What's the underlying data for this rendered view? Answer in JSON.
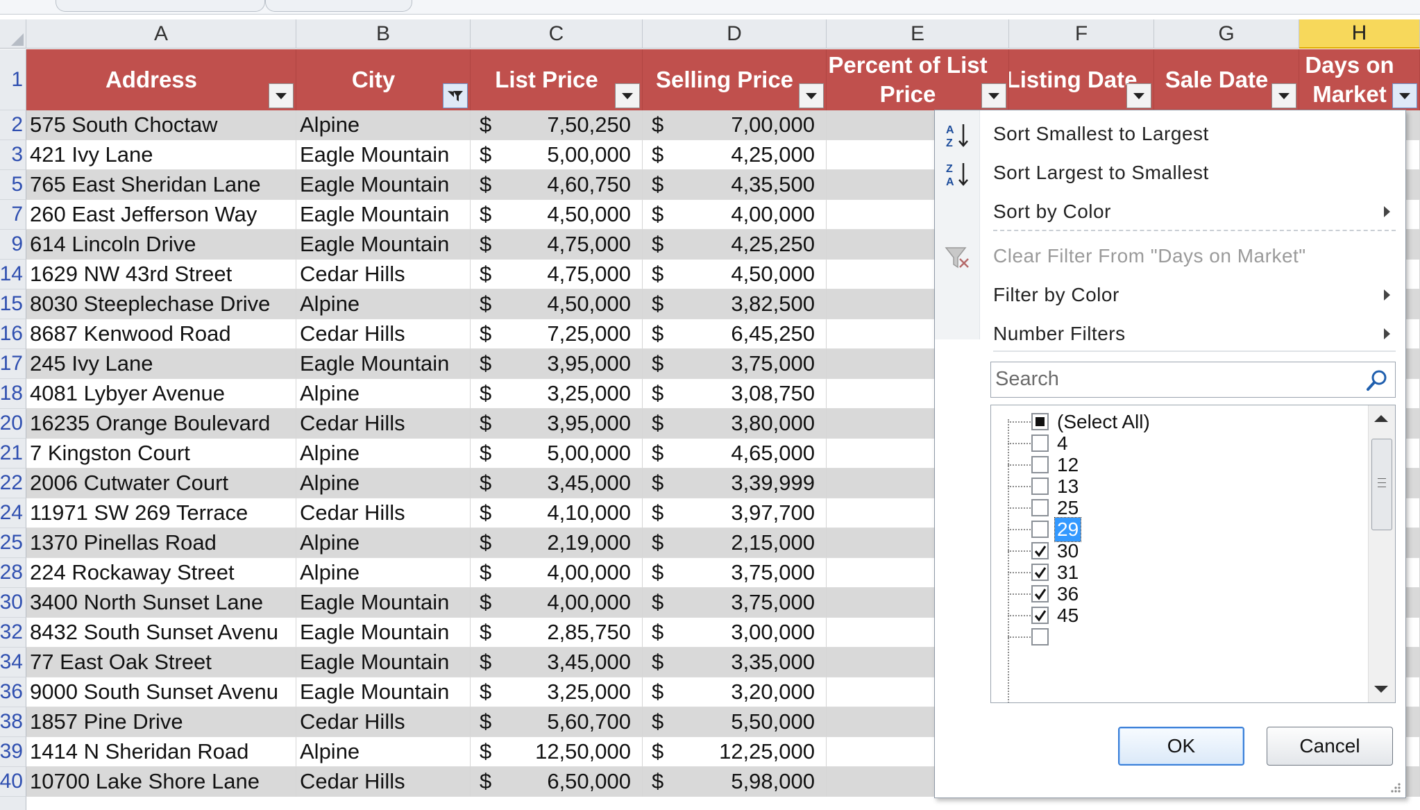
{
  "columns": [
    "A",
    "B",
    "C",
    "D",
    "E",
    "F",
    "G",
    "H"
  ],
  "header_row_number": "1",
  "table_headers": {
    "address": "Address",
    "city": "City",
    "list_price": "List Price",
    "selling_price": "Selling Price",
    "percent_of_list_price": "Percent of List Price",
    "listing_date": "Listing Date",
    "sale_date": "Sale Date",
    "days_on_market": "Days on Market"
  },
  "currency_symbol": "$",
  "rows": [
    {
      "row": "2",
      "address": "575 South Choctaw",
      "city": "Alpine",
      "list_price": "7,50,250",
      "selling_price": "7,00,000"
    },
    {
      "row": "3",
      "address": "421 Ivy Lane",
      "city": "Eagle Mountain",
      "list_price": "5,00,000",
      "selling_price": "4,25,000"
    },
    {
      "row": "5",
      "address": "765 East Sheridan Lane",
      "city": "Eagle Mountain",
      "list_price": "4,60,750",
      "selling_price": "4,35,500"
    },
    {
      "row": "7",
      "address": "260 East Jefferson Way",
      "city": "Eagle Mountain",
      "list_price": "4,50,000",
      "selling_price": "4,00,000"
    },
    {
      "row": "9",
      "address": "614 Lincoln Drive",
      "city": "Eagle Mountain",
      "list_price": "4,75,000",
      "selling_price": "4,25,250"
    },
    {
      "row": "14",
      "address": "1629 NW 43rd Street",
      "city": "Cedar Hills",
      "list_price": "4,75,000",
      "selling_price": "4,50,000"
    },
    {
      "row": "15",
      "address": "8030 Steeplechase Drive",
      "city": "Alpine",
      "list_price": "4,50,000",
      "selling_price": "3,82,500"
    },
    {
      "row": "16",
      "address": "8687 Kenwood Road",
      "city": "Cedar Hills",
      "list_price": "7,25,000",
      "selling_price": "6,45,250"
    },
    {
      "row": "17",
      "address": "245 Ivy Lane",
      "city": "Eagle Mountain",
      "list_price": "3,95,000",
      "selling_price": "3,75,000"
    },
    {
      "row": "18",
      "address": "4081 Lybyer Avenue",
      "city": "Alpine",
      "list_price": "3,25,000",
      "selling_price": "3,08,750"
    },
    {
      "row": "20",
      "address": "16235 Orange Boulevard",
      "city": "Cedar Hills",
      "list_price": "3,95,000",
      "selling_price": "3,80,000"
    },
    {
      "row": "21",
      "address": "7 Kingston Court",
      "city": "Alpine",
      "list_price": "5,00,000",
      "selling_price": "4,65,000"
    },
    {
      "row": "22",
      "address": "2006 Cutwater Court",
      "city": "Alpine",
      "list_price": "3,45,000",
      "selling_price": "3,39,999"
    },
    {
      "row": "24",
      "address": "11971 SW 269 Terrace",
      "city": "Cedar Hills",
      "list_price": "4,10,000",
      "selling_price": "3,97,700"
    },
    {
      "row": "25",
      "address": "1370 Pinellas Road",
      "city": "Alpine",
      "list_price": "2,19,000",
      "selling_price": "2,15,000"
    },
    {
      "row": "28",
      "address": "224 Rockaway Street",
      "city": "Alpine",
      "list_price": "4,00,000",
      "selling_price": "3,75,000"
    },
    {
      "row": "30",
      "address": "3400 North Sunset Lane",
      "city": "Eagle Mountain",
      "list_price": "4,00,000",
      "selling_price": "3,75,000"
    },
    {
      "row": "32",
      "address": "8432 South Sunset Avenu",
      "city": "Eagle Mountain",
      "list_price": "2,85,750",
      "selling_price": "3,00,000"
    },
    {
      "row": "34",
      "address": "77 East Oak Street",
      "city": "Eagle Mountain",
      "list_price": "3,45,000",
      "selling_price": "3,35,000"
    },
    {
      "row": "36",
      "address": "9000 South Sunset Avenu",
      "city": "Eagle Mountain",
      "list_price": "3,25,000",
      "selling_price": "3,20,000"
    },
    {
      "row": "38",
      "address": "1857 Pine Drive",
      "city": "Cedar Hills",
      "list_price": "5,60,700",
      "selling_price": "5,50,000"
    },
    {
      "row": "39",
      "address": "1414 N Sheridan Road",
      "city": "Alpine",
      "list_price": "12,50,000",
      "selling_price": "12,25,000"
    },
    {
      "row": "40",
      "address": "10700 Lake Shore Lane",
      "city": "Cedar Hills",
      "list_price": "6,50,000",
      "selling_price": "5,98,000"
    }
  ],
  "filter_menu": {
    "sort_asc": "Sort Smallest to Largest",
    "sort_desc": "Sort Largest to Smallest",
    "sort_by_color": "Sort by Color",
    "clear_filter": "Clear Filter From \"Days on Market\"",
    "filter_by_color": "Filter by Color",
    "number_filters": "Number Filters",
    "search_placeholder": "Search",
    "items": [
      {
        "label": "(Select All)",
        "state": "mixed"
      },
      {
        "label": "4",
        "state": "unchecked"
      },
      {
        "label": "12",
        "state": "unchecked"
      },
      {
        "label": "13",
        "state": "unchecked"
      },
      {
        "label": "25",
        "state": "unchecked"
      },
      {
        "label": "29",
        "state": "unchecked",
        "focused": true
      },
      {
        "label": "30",
        "state": "checked"
      },
      {
        "label": "31",
        "state": "checked"
      },
      {
        "label": "36",
        "state": "checked"
      },
      {
        "label": "45",
        "state": "checked"
      }
    ],
    "ok": "OK",
    "cancel": "Cancel"
  },
  "colors": {
    "header_red": "#c0504d",
    "band_gray": "#d9d9d9",
    "selected_col": "#f7d85b",
    "row_number_blue": "#2f4fb0"
  }
}
